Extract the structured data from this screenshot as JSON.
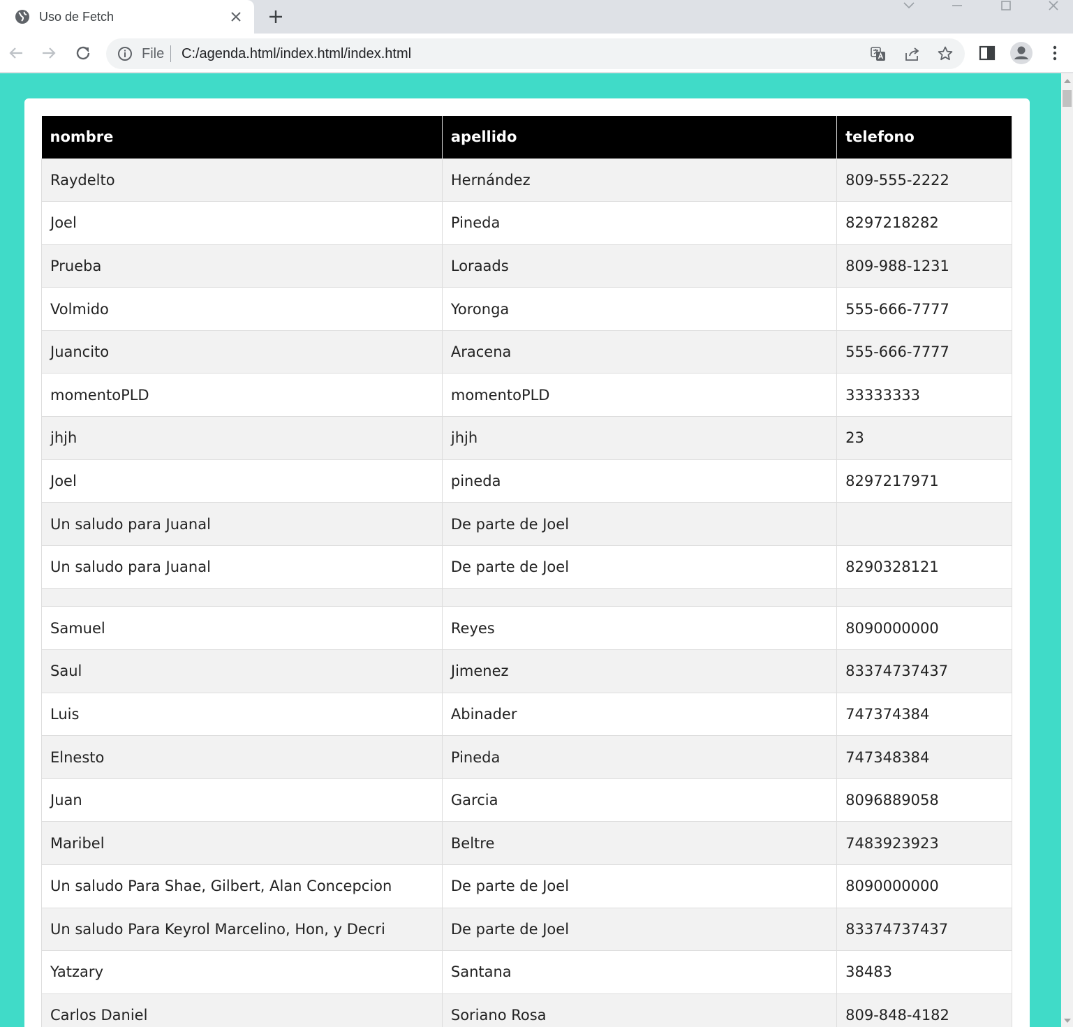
{
  "browser": {
    "tab_title": "Uso de Fetch",
    "scheme_label": "File",
    "url": "C:/agenda.html/index.html/index.html"
  },
  "table": {
    "headers": [
      "nombre",
      "apellido",
      "telefono"
    ],
    "rows": [
      [
        "Raydelto",
        "Hernández",
        "809-555-2222"
      ],
      [
        "Joel",
        "Pineda",
        "8297218282"
      ],
      [
        "Prueba",
        "Loraads",
        "809-988-1231"
      ],
      [
        "Volmido",
        "Yoronga",
        "555-666-7777"
      ],
      [
        "Juancito",
        "Aracena",
        "555-666-7777"
      ],
      [
        "momentoPLD",
        "momentoPLD",
        "33333333"
      ],
      [
        "jhjh",
        "jhjh",
        "23"
      ],
      [
        "Joel",
        "pineda",
        "8297217971"
      ],
      [
        "Un saludo para Juanal",
        "De parte de Joel",
        ""
      ],
      [
        "Un saludo para Juanal",
        "De parte de Joel",
        "8290328121"
      ],
      [
        "",
        "",
        ""
      ],
      [
        "Samuel",
        "Reyes",
        "8090000000"
      ],
      [
        "Saul",
        "Jimenez",
        "83374737437"
      ],
      [
        "Luis",
        "Abinader",
        "747374384"
      ],
      [
        "Elnesto",
        "Pineda",
        "747348384"
      ],
      [
        "Juan",
        "Garcia",
        "8096889058"
      ],
      [
        "Maribel",
        "Beltre",
        "7483923923"
      ],
      [
        "Un saludo Para Shae, Gilbert, Alan Concepcion",
        "De parte de Joel",
        "8090000000"
      ],
      [
        "Un saludo Para Keyrol Marcelino, Hon, y Decri",
        "De parte de Joel",
        "83374737437"
      ],
      [
        "Yatzary",
        "Santana",
        "38483"
      ],
      [
        "Carlos Daniel",
        "Soriano Rosa",
        "809-848-4182"
      ]
    ]
  },
  "colors": {
    "page_background": "#40dbc8",
    "header_background": "#000000",
    "stripe": "#f2f2f2"
  }
}
